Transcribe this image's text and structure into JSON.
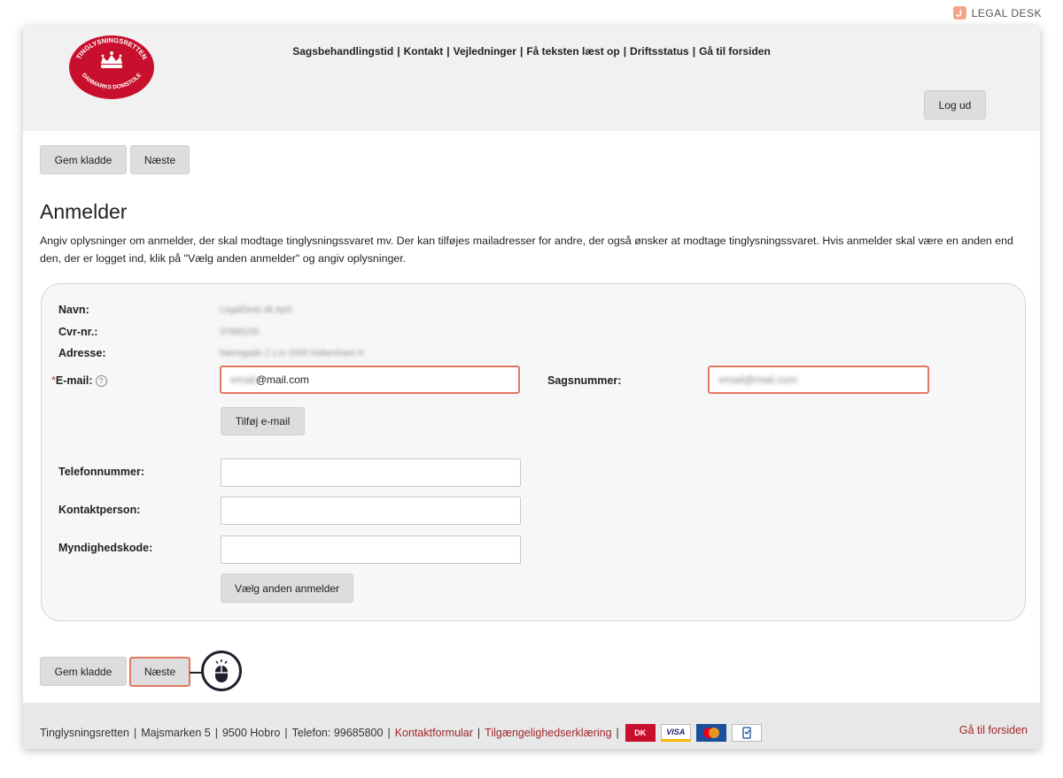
{
  "brand": {
    "label": "LEGAL DESK"
  },
  "header": {
    "logo_top_text": "TINGLYSNINGSRETTEN",
    "logo_bottom_text": "DANMARKS DOMSTOLE",
    "nav": [
      "Sagsbehandlingstid",
      "Kontakt",
      "Vejledninger",
      "Få teksten læst op",
      "Driftsstatus",
      "Gå til forsiden"
    ],
    "separator": "|",
    "logout_label": "Log ud"
  },
  "toolbar_top": {
    "save_draft": "Gem kladde",
    "next": "Næste"
  },
  "page": {
    "title": "Anmelder",
    "intro": "Angiv oplysninger om anmelder, der skal modtage tinglysningssvaret mv. Der kan tilføjes mailadresser for andre, der også ønsker at modtage tinglysningssvaret. Hvis anmelder skal være en anden end den, der er logget ind, klik på \"Vælg anden anmelder\" og angiv oplysninger."
  },
  "form": {
    "name_label": "Navn:",
    "name_value": "LegalDesk dk ApS",
    "cvr_label": "Cvr-nr.:",
    "cvr_value": "37985235",
    "address_label": "Adresse:",
    "address_value": "Nørregade 2 1.tv 2000 København K",
    "email_required_mark": "*",
    "email_label": "E-mail:",
    "email_help_icon": "question-circle-icon",
    "email_value_hidden": "email",
    "email_value_visible": "@mail.com",
    "case_number_label": "Sagsnummer:",
    "case_number_value": "email@mail.com",
    "add_email_button": "Tilføj e-mail",
    "phone_label": "Telefonnummer:",
    "phone_value": "",
    "contact_label": "Kontaktperson:",
    "contact_value": "",
    "authority_label": "Myndighedskode:",
    "authority_value": "",
    "choose_other_button": "Vælg anden anmelder"
  },
  "toolbar_bottom": {
    "save_draft": "Gem kladde",
    "next": "Næste"
  },
  "footer": {
    "address_parts": [
      "Tinglysningsretten",
      "Majsmarken 5",
      "9500 Hobro",
      "Telefon: 99685800"
    ],
    "contact_link": "Kontaktformular",
    "accessibility_link": "Tilgængelighedserklæring",
    "payment_icons": [
      "dankort-icon",
      "visa-icon",
      "mastercard-icon",
      "mobile-pay-icon"
    ],
    "dankort_text": "DK",
    "visa_text": "VISA",
    "front_page_link": "Gå til forsiden"
  },
  "colors": {
    "highlight": "#e07862",
    "link_red": "#a0282b",
    "logo_red": "#c8102e"
  }
}
